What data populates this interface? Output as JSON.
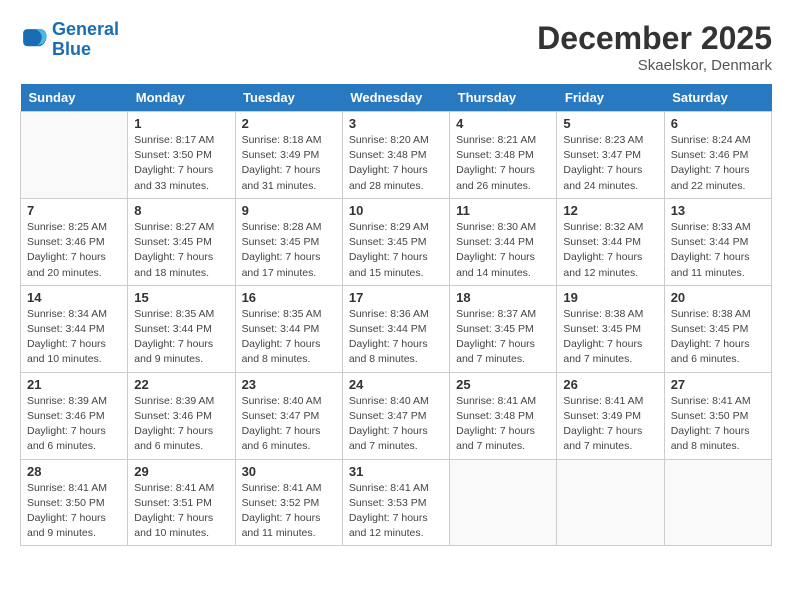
{
  "header": {
    "logo_general": "General",
    "logo_blue": "Blue",
    "month_year": "December 2025",
    "location": "Skaelskor, Denmark"
  },
  "days_of_week": [
    "Sunday",
    "Monday",
    "Tuesday",
    "Wednesday",
    "Thursday",
    "Friday",
    "Saturday"
  ],
  "weeks": [
    [
      {
        "day": "",
        "info": ""
      },
      {
        "day": "1",
        "info": "Sunrise: 8:17 AM\nSunset: 3:50 PM\nDaylight: 7 hours\nand 33 minutes."
      },
      {
        "day": "2",
        "info": "Sunrise: 8:18 AM\nSunset: 3:49 PM\nDaylight: 7 hours\nand 31 minutes."
      },
      {
        "day": "3",
        "info": "Sunrise: 8:20 AM\nSunset: 3:48 PM\nDaylight: 7 hours\nand 28 minutes."
      },
      {
        "day": "4",
        "info": "Sunrise: 8:21 AM\nSunset: 3:48 PM\nDaylight: 7 hours\nand 26 minutes."
      },
      {
        "day": "5",
        "info": "Sunrise: 8:23 AM\nSunset: 3:47 PM\nDaylight: 7 hours\nand 24 minutes."
      },
      {
        "day": "6",
        "info": "Sunrise: 8:24 AM\nSunset: 3:46 PM\nDaylight: 7 hours\nand 22 minutes."
      }
    ],
    [
      {
        "day": "7",
        "info": "Sunrise: 8:25 AM\nSunset: 3:46 PM\nDaylight: 7 hours\nand 20 minutes."
      },
      {
        "day": "8",
        "info": "Sunrise: 8:27 AM\nSunset: 3:45 PM\nDaylight: 7 hours\nand 18 minutes."
      },
      {
        "day": "9",
        "info": "Sunrise: 8:28 AM\nSunset: 3:45 PM\nDaylight: 7 hours\nand 17 minutes."
      },
      {
        "day": "10",
        "info": "Sunrise: 8:29 AM\nSunset: 3:45 PM\nDaylight: 7 hours\nand 15 minutes."
      },
      {
        "day": "11",
        "info": "Sunrise: 8:30 AM\nSunset: 3:44 PM\nDaylight: 7 hours\nand 14 minutes."
      },
      {
        "day": "12",
        "info": "Sunrise: 8:32 AM\nSunset: 3:44 PM\nDaylight: 7 hours\nand 12 minutes."
      },
      {
        "day": "13",
        "info": "Sunrise: 8:33 AM\nSunset: 3:44 PM\nDaylight: 7 hours\nand 11 minutes."
      }
    ],
    [
      {
        "day": "14",
        "info": "Sunrise: 8:34 AM\nSunset: 3:44 PM\nDaylight: 7 hours\nand 10 minutes."
      },
      {
        "day": "15",
        "info": "Sunrise: 8:35 AM\nSunset: 3:44 PM\nDaylight: 7 hours\nand 9 minutes."
      },
      {
        "day": "16",
        "info": "Sunrise: 8:35 AM\nSunset: 3:44 PM\nDaylight: 7 hours\nand 8 minutes."
      },
      {
        "day": "17",
        "info": "Sunrise: 8:36 AM\nSunset: 3:44 PM\nDaylight: 7 hours\nand 8 minutes."
      },
      {
        "day": "18",
        "info": "Sunrise: 8:37 AM\nSunset: 3:45 PM\nDaylight: 7 hours\nand 7 minutes."
      },
      {
        "day": "19",
        "info": "Sunrise: 8:38 AM\nSunset: 3:45 PM\nDaylight: 7 hours\nand 7 minutes."
      },
      {
        "day": "20",
        "info": "Sunrise: 8:38 AM\nSunset: 3:45 PM\nDaylight: 7 hours\nand 6 minutes."
      }
    ],
    [
      {
        "day": "21",
        "info": "Sunrise: 8:39 AM\nSunset: 3:46 PM\nDaylight: 7 hours\nand 6 minutes."
      },
      {
        "day": "22",
        "info": "Sunrise: 8:39 AM\nSunset: 3:46 PM\nDaylight: 7 hours\nand 6 minutes."
      },
      {
        "day": "23",
        "info": "Sunrise: 8:40 AM\nSunset: 3:47 PM\nDaylight: 7 hours\nand 6 minutes."
      },
      {
        "day": "24",
        "info": "Sunrise: 8:40 AM\nSunset: 3:47 PM\nDaylight: 7 hours\nand 7 minutes."
      },
      {
        "day": "25",
        "info": "Sunrise: 8:41 AM\nSunset: 3:48 PM\nDaylight: 7 hours\nand 7 minutes."
      },
      {
        "day": "26",
        "info": "Sunrise: 8:41 AM\nSunset: 3:49 PM\nDaylight: 7 hours\nand 7 minutes."
      },
      {
        "day": "27",
        "info": "Sunrise: 8:41 AM\nSunset: 3:50 PM\nDaylight: 7 hours\nand 8 minutes."
      }
    ],
    [
      {
        "day": "28",
        "info": "Sunrise: 8:41 AM\nSunset: 3:50 PM\nDaylight: 7 hours\nand 9 minutes."
      },
      {
        "day": "29",
        "info": "Sunrise: 8:41 AM\nSunset: 3:51 PM\nDaylight: 7 hours\nand 10 minutes."
      },
      {
        "day": "30",
        "info": "Sunrise: 8:41 AM\nSunset: 3:52 PM\nDaylight: 7 hours\nand 11 minutes."
      },
      {
        "day": "31",
        "info": "Sunrise: 8:41 AM\nSunset: 3:53 PM\nDaylight: 7 hours\nand 12 minutes."
      },
      {
        "day": "",
        "info": ""
      },
      {
        "day": "",
        "info": ""
      },
      {
        "day": "",
        "info": ""
      }
    ]
  ]
}
